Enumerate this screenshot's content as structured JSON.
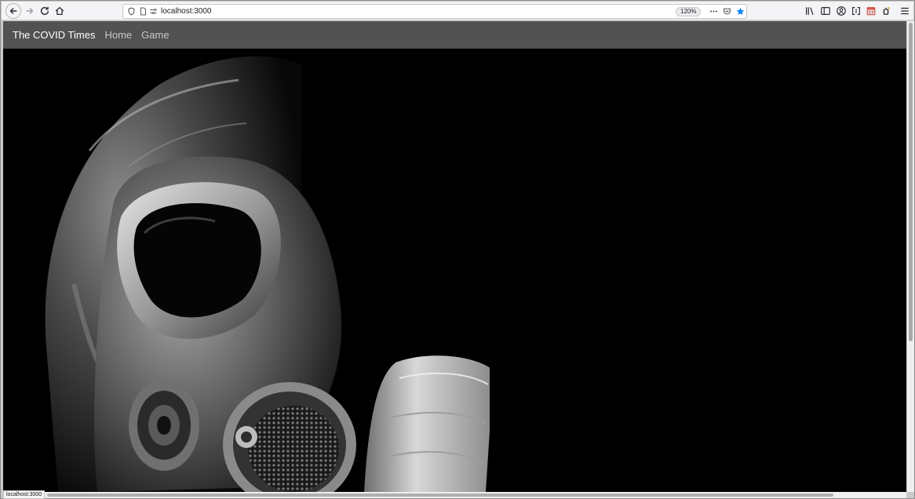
{
  "browser": {
    "url": "localhost:3000",
    "zoom": "120%",
    "status_text": "localhost:3000",
    "accent_color": "#0a84ff",
    "icons": {
      "back": "back-arrow-icon",
      "forward": "forward-arrow-icon",
      "reload": "reload-icon",
      "home": "home-icon",
      "shield": "tracking-shield-icon",
      "page": "page-icon",
      "permissions": "permissions-icon",
      "more": "more-actions-icon",
      "pocket": "pocket-icon",
      "bookmark": "bookmark-star-icon",
      "library": "library-icon",
      "sidebar": "sidebar-icon",
      "account": "account-icon",
      "extensions": [
        "extension-icon",
        "calendar-extension-icon",
        "bug-extension-icon"
      ],
      "menu": "hamburger-menu-icon"
    }
  },
  "site": {
    "brand": "The COVID Times",
    "nav": [
      {
        "label": "Home"
      },
      {
        "label": "Game"
      }
    ],
    "navbar_color": "#525252",
    "hero_alt": "gas mask"
  }
}
